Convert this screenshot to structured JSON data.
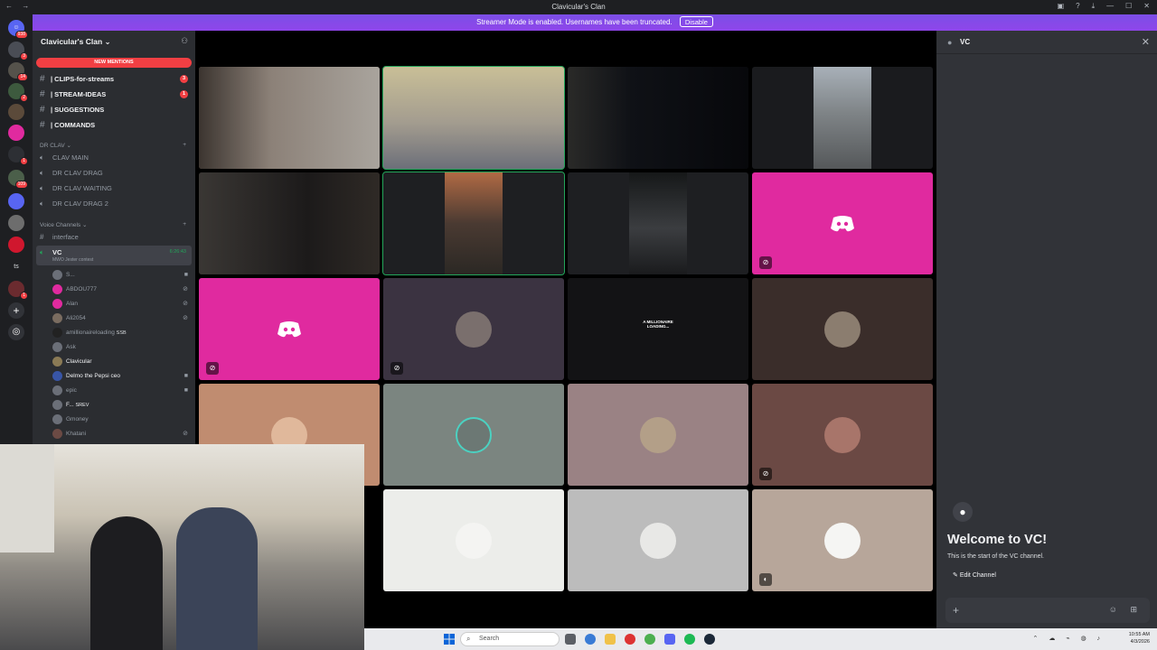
{
  "window": {
    "title": "Clavicular's Clan",
    "nav": "← →"
  },
  "banner": {
    "text": "Streamer Mode is enabled. Usernames have been truncated.",
    "button": "Disable"
  },
  "server": {
    "name": "Clavicular's Clan",
    "new_mentions": "NEW MENTIONS"
  },
  "rail": {
    "home_badge": "938",
    "badges": [
      "3",
      "14",
      "2",
      "1",
      "109",
      "1"
    ],
    "ts_label": "ts"
  },
  "text_channels": [
    {
      "label": "| CLIPS-for-streams",
      "badge": "3"
    },
    {
      "label": "| STREAM-IDEAS",
      "badge": "1"
    },
    {
      "label": "| SUGGESTIONS",
      "badge": ""
    },
    {
      "label": "| COMMANDS",
      "badge": ""
    }
  ],
  "categories": {
    "drclav": "DR CLAV",
    "voice": "Voice Channels"
  },
  "drclav_channels": [
    "CLAV MAIN",
    "DR CLAV DRAG",
    "DR CLAV WAITING",
    "DR CLAV DRAG 2"
  ],
  "voice": {
    "interface": "interface",
    "active_name": "VC",
    "active_sub": "MWO Jester contest",
    "timer": "6:26:43"
  },
  "members": [
    {
      "name": "S..."
    },
    {
      "name": "ABDOU777"
    },
    {
      "name": "Alan"
    },
    {
      "name": "Ali2054"
    },
    {
      "name": "amillionaireloading",
      "tag": "SSB"
    },
    {
      "name": "Ask"
    },
    {
      "name": "Clavicular"
    },
    {
      "name": "Delmo the Pepsi ceo"
    },
    {
      "name": "epic"
    },
    {
      "name": "F...",
      "tag": "SREV"
    },
    {
      "name": "Gmoney"
    },
    {
      "name": "Khatani"
    }
  ],
  "tile_texts": {
    "millionaire": "A MILLIONAIRE LOADING..."
  },
  "right_panel": {
    "header": "VC",
    "welcome": "Welcome to VC!",
    "start": "This is the start of the VC channel.",
    "edit": "Edit Channel"
  },
  "taskbar": {
    "search": "Search",
    "time": "10:55 AM",
    "date": "4/3/2026"
  },
  "colors": {
    "accent": "#5865f2",
    "banner": "#8a47e8",
    "discord_pink": "#e02a9f",
    "speaking": "#23a55a",
    "mention_red": "#f23f43"
  }
}
